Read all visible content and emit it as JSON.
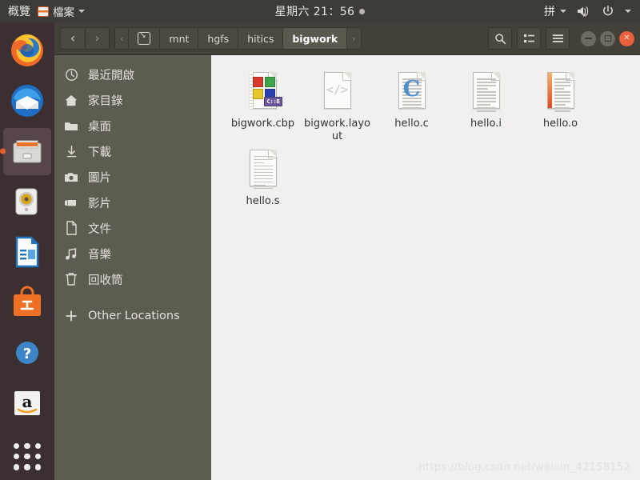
{
  "topbar": {
    "activities": "概覽",
    "app_name": "檔案",
    "app_icon": "files-icon",
    "clock": "星期六 21：56",
    "ime": "拼",
    "volume_icon": "volume-muted-icon",
    "power_icon": "power-icon"
  },
  "dock": {
    "items": [
      {
        "name": "firefox",
        "label": "Firefox",
        "active": false
      },
      {
        "name": "thunderbird",
        "label": "Thunderbird",
        "active": false
      },
      {
        "name": "files",
        "label": "Files",
        "active": true
      },
      {
        "name": "rhythmbox",
        "label": "Rhythmbox",
        "active": false
      },
      {
        "name": "libreoffice-impress",
        "label": "LibreOffice Impress",
        "active": false
      },
      {
        "name": "ubuntu-software",
        "label": "Ubuntu Software",
        "active": false
      },
      {
        "name": "help",
        "label": "Help",
        "active": false
      },
      {
        "name": "amazon",
        "label": "Amazon",
        "active": false
      },
      {
        "name": "show-applications",
        "label": "Show Applications",
        "active": false
      }
    ]
  },
  "window": {
    "nav": {
      "back": "‹",
      "forward": "›"
    },
    "path": {
      "overflow_left": "‹",
      "overflow_right": "›",
      "device_icon": "remote-drive-icon",
      "segments": [
        {
          "label": "mnt",
          "current": false
        },
        {
          "label": "hgfs",
          "current": false
        },
        {
          "label": "hitics",
          "current": false
        },
        {
          "label": "bigwork",
          "current": true
        }
      ]
    },
    "toolbar": {
      "search_icon": "search-icon",
      "view_icon": "list-view-icon",
      "menu_icon": "hamburger-menu-icon"
    },
    "controls": {
      "minimize": "minimize-button",
      "maximize": "maximize-button",
      "close": "close-button"
    }
  },
  "sidebar": {
    "items": [
      {
        "label": "最近開啟",
        "icon": "clock-icon"
      },
      {
        "label": "家目錄",
        "icon": "home-icon"
      },
      {
        "label": "桌面",
        "icon": "folder-icon"
      },
      {
        "label": "下載",
        "icon": "download-icon"
      },
      {
        "label": "圖片",
        "icon": "camera-icon"
      },
      {
        "label": "影片",
        "icon": "video-icon"
      },
      {
        "label": "文件",
        "icon": "document-icon"
      },
      {
        "label": "音樂",
        "icon": "music-icon"
      },
      {
        "label": "回收筒",
        "icon": "trash-icon"
      }
    ],
    "other_locations": {
      "label": "Other Locations",
      "icon": "plus-icon"
    }
  },
  "files": [
    {
      "name": "bigwork.cbp",
      "type": "codeblocks-project",
      "badge": "C::B"
    },
    {
      "name": "bigwork.layout",
      "type": "xml-code",
      "glyph": "</>"
    },
    {
      "name": "hello.c",
      "type": "c-source",
      "glyph": "C"
    },
    {
      "name": "hello.i",
      "type": "text-document"
    },
    {
      "name": "hello.o",
      "type": "object-binary"
    },
    {
      "name": "hello.s",
      "type": "text-document"
    }
  ],
  "watermark": "https://blog.csdn.net/weixin_42158152",
  "colors": {
    "topbar_bg": "#3c3b37",
    "dock_bg": "#3b2f31",
    "headerbar_bg": "#434039",
    "sidebar_bg": "#5d5c50",
    "content_bg": "#f1f0ee",
    "accent_orange": "#e8612c",
    "close_red": "#e8603c"
  }
}
